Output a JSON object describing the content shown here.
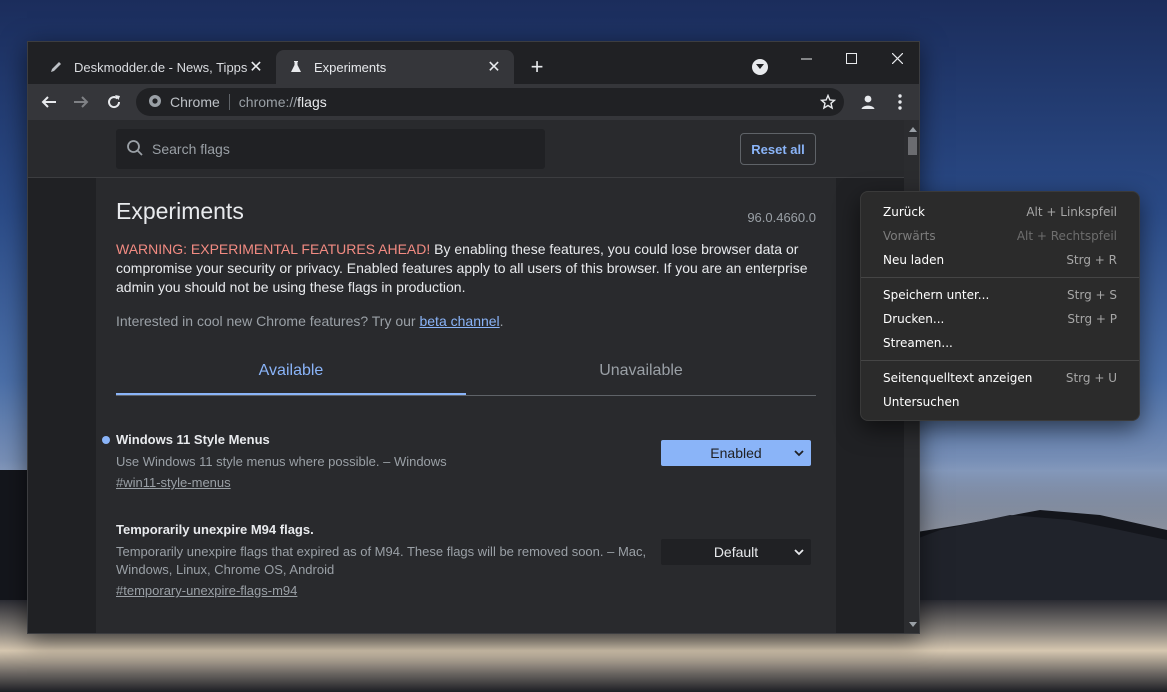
{
  "browser": {
    "tabs": [
      {
        "title": "Deskmodder.de - News, Tipps und",
        "favicon": "pen-icon"
      },
      {
        "title": "Experiments",
        "favicon": "flask-icon"
      }
    ],
    "omnibox": {
      "scheme_label": "Chrome",
      "url_prefix": "chrome://",
      "url_host": "flags"
    }
  },
  "flags_page": {
    "search_placeholder": "Search flags",
    "reset_label": "Reset all",
    "title": "Experiments",
    "version": "96.0.4660.0",
    "warning_highlight": "WARNING: EXPERIMENTAL FEATURES AHEAD!",
    "warning_text": " By enabling these features, you could lose browser data or compromise your security or privacy. Enabled features apply to all users of this browser. If you are an enterprise admin you should not be using these flags in production.",
    "promo_text": "Interested in cool new Chrome features? Try our ",
    "promo_link": "beta channel",
    "promo_end": ".",
    "tabs": {
      "available": "Available",
      "unavailable": "Unavailable"
    },
    "flags": [
      {
        "title": "Windows 11 Style Menus",
        "description": "Use Windows 11 style menus where possible. – Windows",
        "link": "#win11-style-menus",
        "state": "Enabled"
      },
      {
        "title": "Temporarily unexpire M94 flags.",
        "description": "Temporarily unexpire flags that expired as of M94. These flags will be removed soon. – Mac, Windows, Linux, Chrome OS, Android",
        "link": "#temporary-unexpire-flags-m94",
        "state": "Default"
      }
    ]
  },
  "context_menu": {
    "items": [
      {
        "label": "Zurück",
        "shortcut": "Alt + Linkspfeil"
      },
      {
        "label": "Vorwärts",
        "shortcut": "Alt + Rechtspfeil"
      },
      {
        "label": "Neu laden",
        "shortcut": "Strg + R"
      },
      {
        "label": "Speichern unter...",
        "shortcut": "Strg + S"
      },
      {
        "label": "Drucken...",
        "shortcut": "Strg + P"
      },
      {
        "label": "Streamen...",
        "shortcut": ""
      },
      {
        "label": "Seitenquelltext anzeigen",
        "shortcut": "Strg + U"
      },
      {
        "label": "Untersuchen",
        "shortcut": ""
      }
    ]
  },
  "colors": {
    "accent": "#8ab4f8",
    "warning": "#f28b82",
    "page_bg": "#292a2d"
  }
}
